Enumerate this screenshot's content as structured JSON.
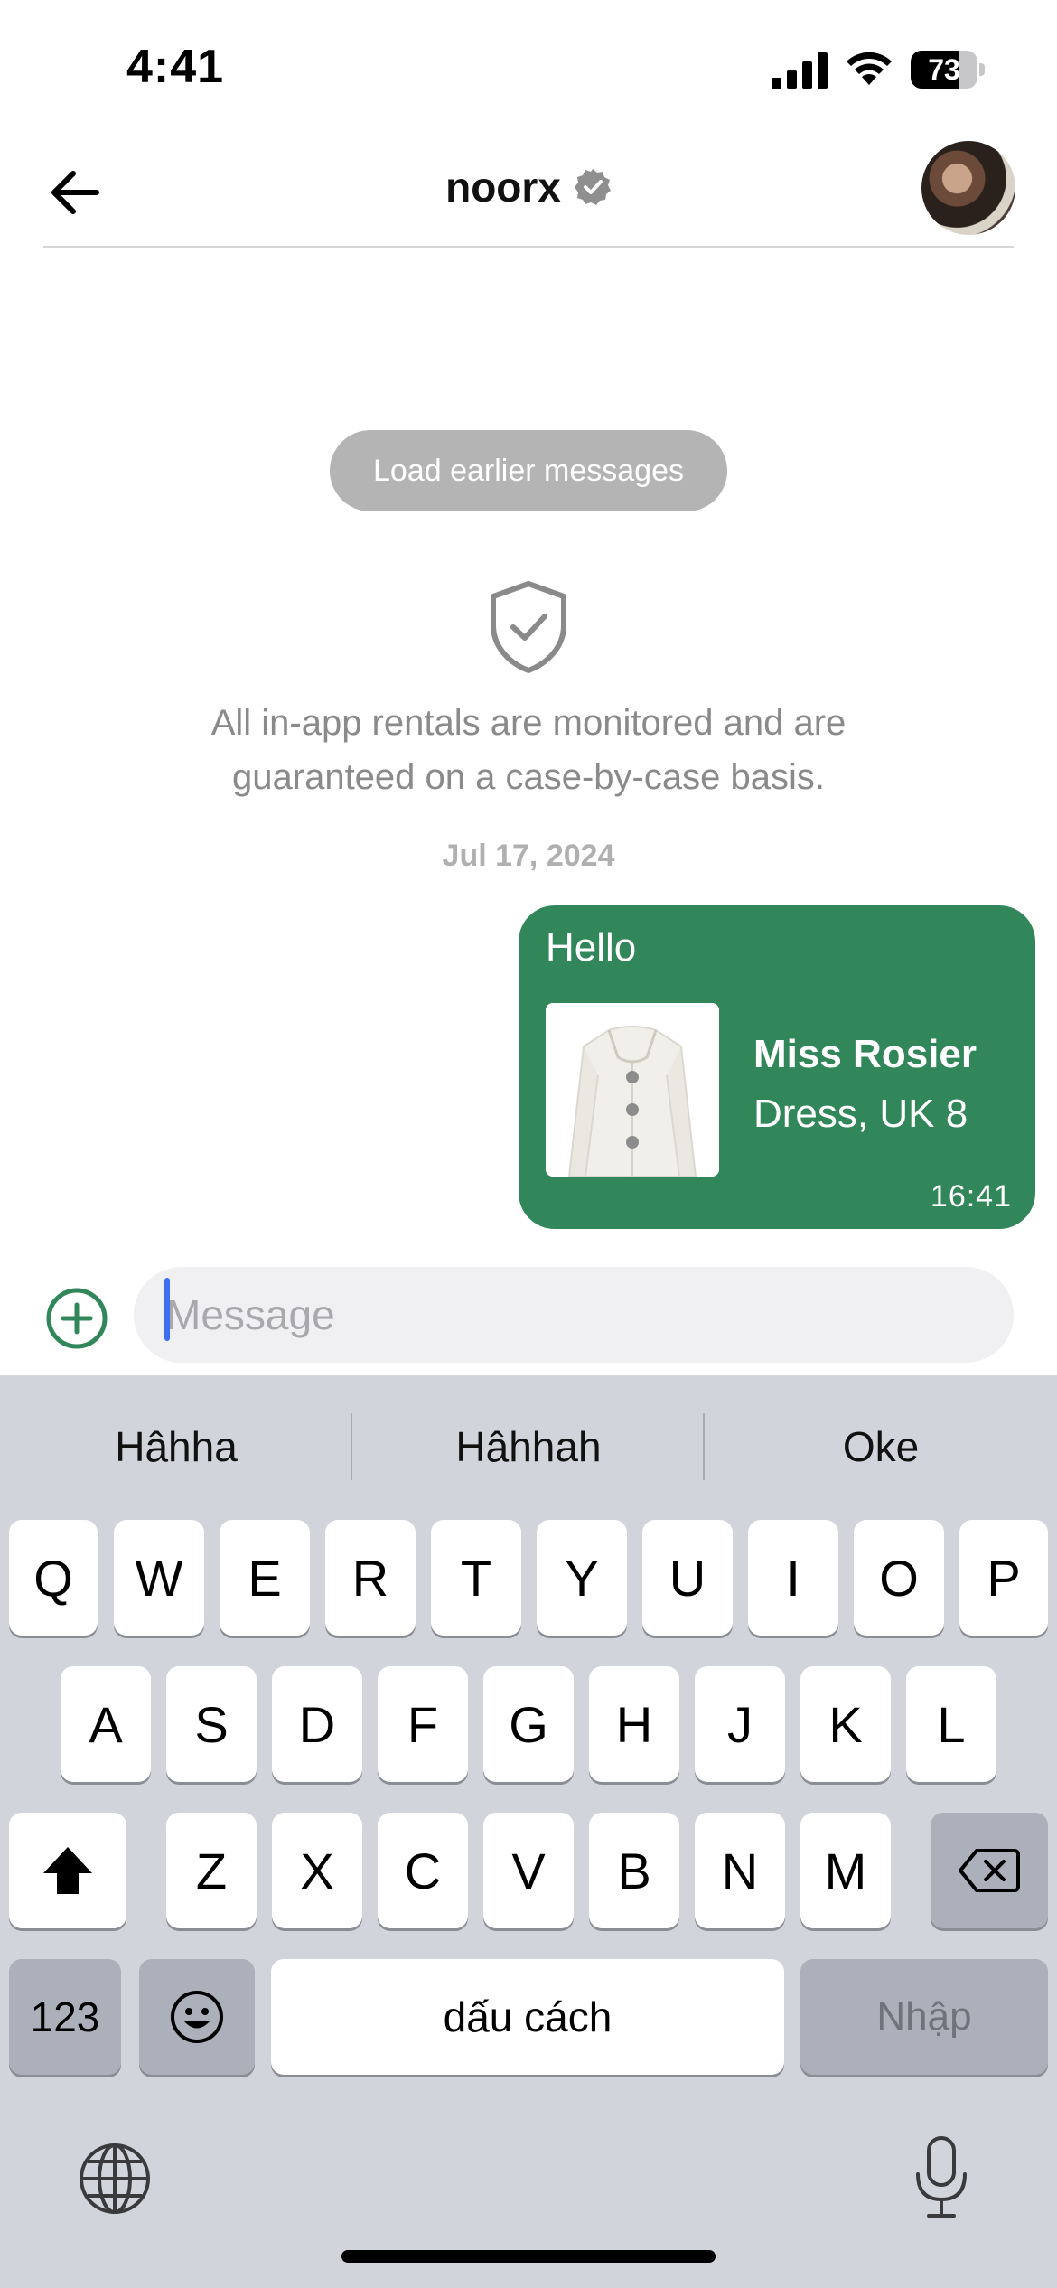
{
  "status_bar": {
    "time": "4:41",
    "battery_percent": "73",
    "battery_level": 0.73,
    "icons": [
      "cellular-signal-icon",
      "wifi-icon",
      "battery-icon"
    ]
  },
  "header": {
    "username": "noorx",
    "verified": true,
    "icons": [
      "back-arrow-icon",
      "verified-badge-icon",
      "avatar"
    ]
  },
  "chat": {
    "load_earlier_label": "Load earlier messages",
    "notice_line1": "All in-app rentals are monitored and are",
    "notice_line2": "guaranteed on a case-by-case basis.",
    "date": "Jul 17, 2024",
    "messages": [
      {
        "text": "Hello",
        "product_name": "Miss Rosier",
        "product_desc": "Dress, UK 8",
        "time": "16:41"
      }
    ]
  },
  "input": {
    "placeholder": "Message"
  },
  "keyboard": {
    "suggestions": [
      "Hâhha",
      "Hâhhah",
      "Oke"
    ],
    "row1": [
      "Q",
      "W",
      "E",
      "R",
      "T",
      "Y",
      "U",
      "I",
      "O",
      "P"
    ],
    "row2": [
      "A",
      "S",
      "D",
      "F",
      "G",
      "H",
      "J",
      "K",
      "L"
    ],
    "row3": [
      "Z",
      "X",
      "C",
      "V",
      "B",
      "N",
      "M"
    ],
    "numbers_label": "123",
    "space_label": "dấu cách",
    "enter_label": "Nhập"
  },
  "colors": {
    "accent_green": "#31875a",
    "caret_blue": "#3b6ff0",
    "keyboard_bg": "#d1d4db"
  }
}
